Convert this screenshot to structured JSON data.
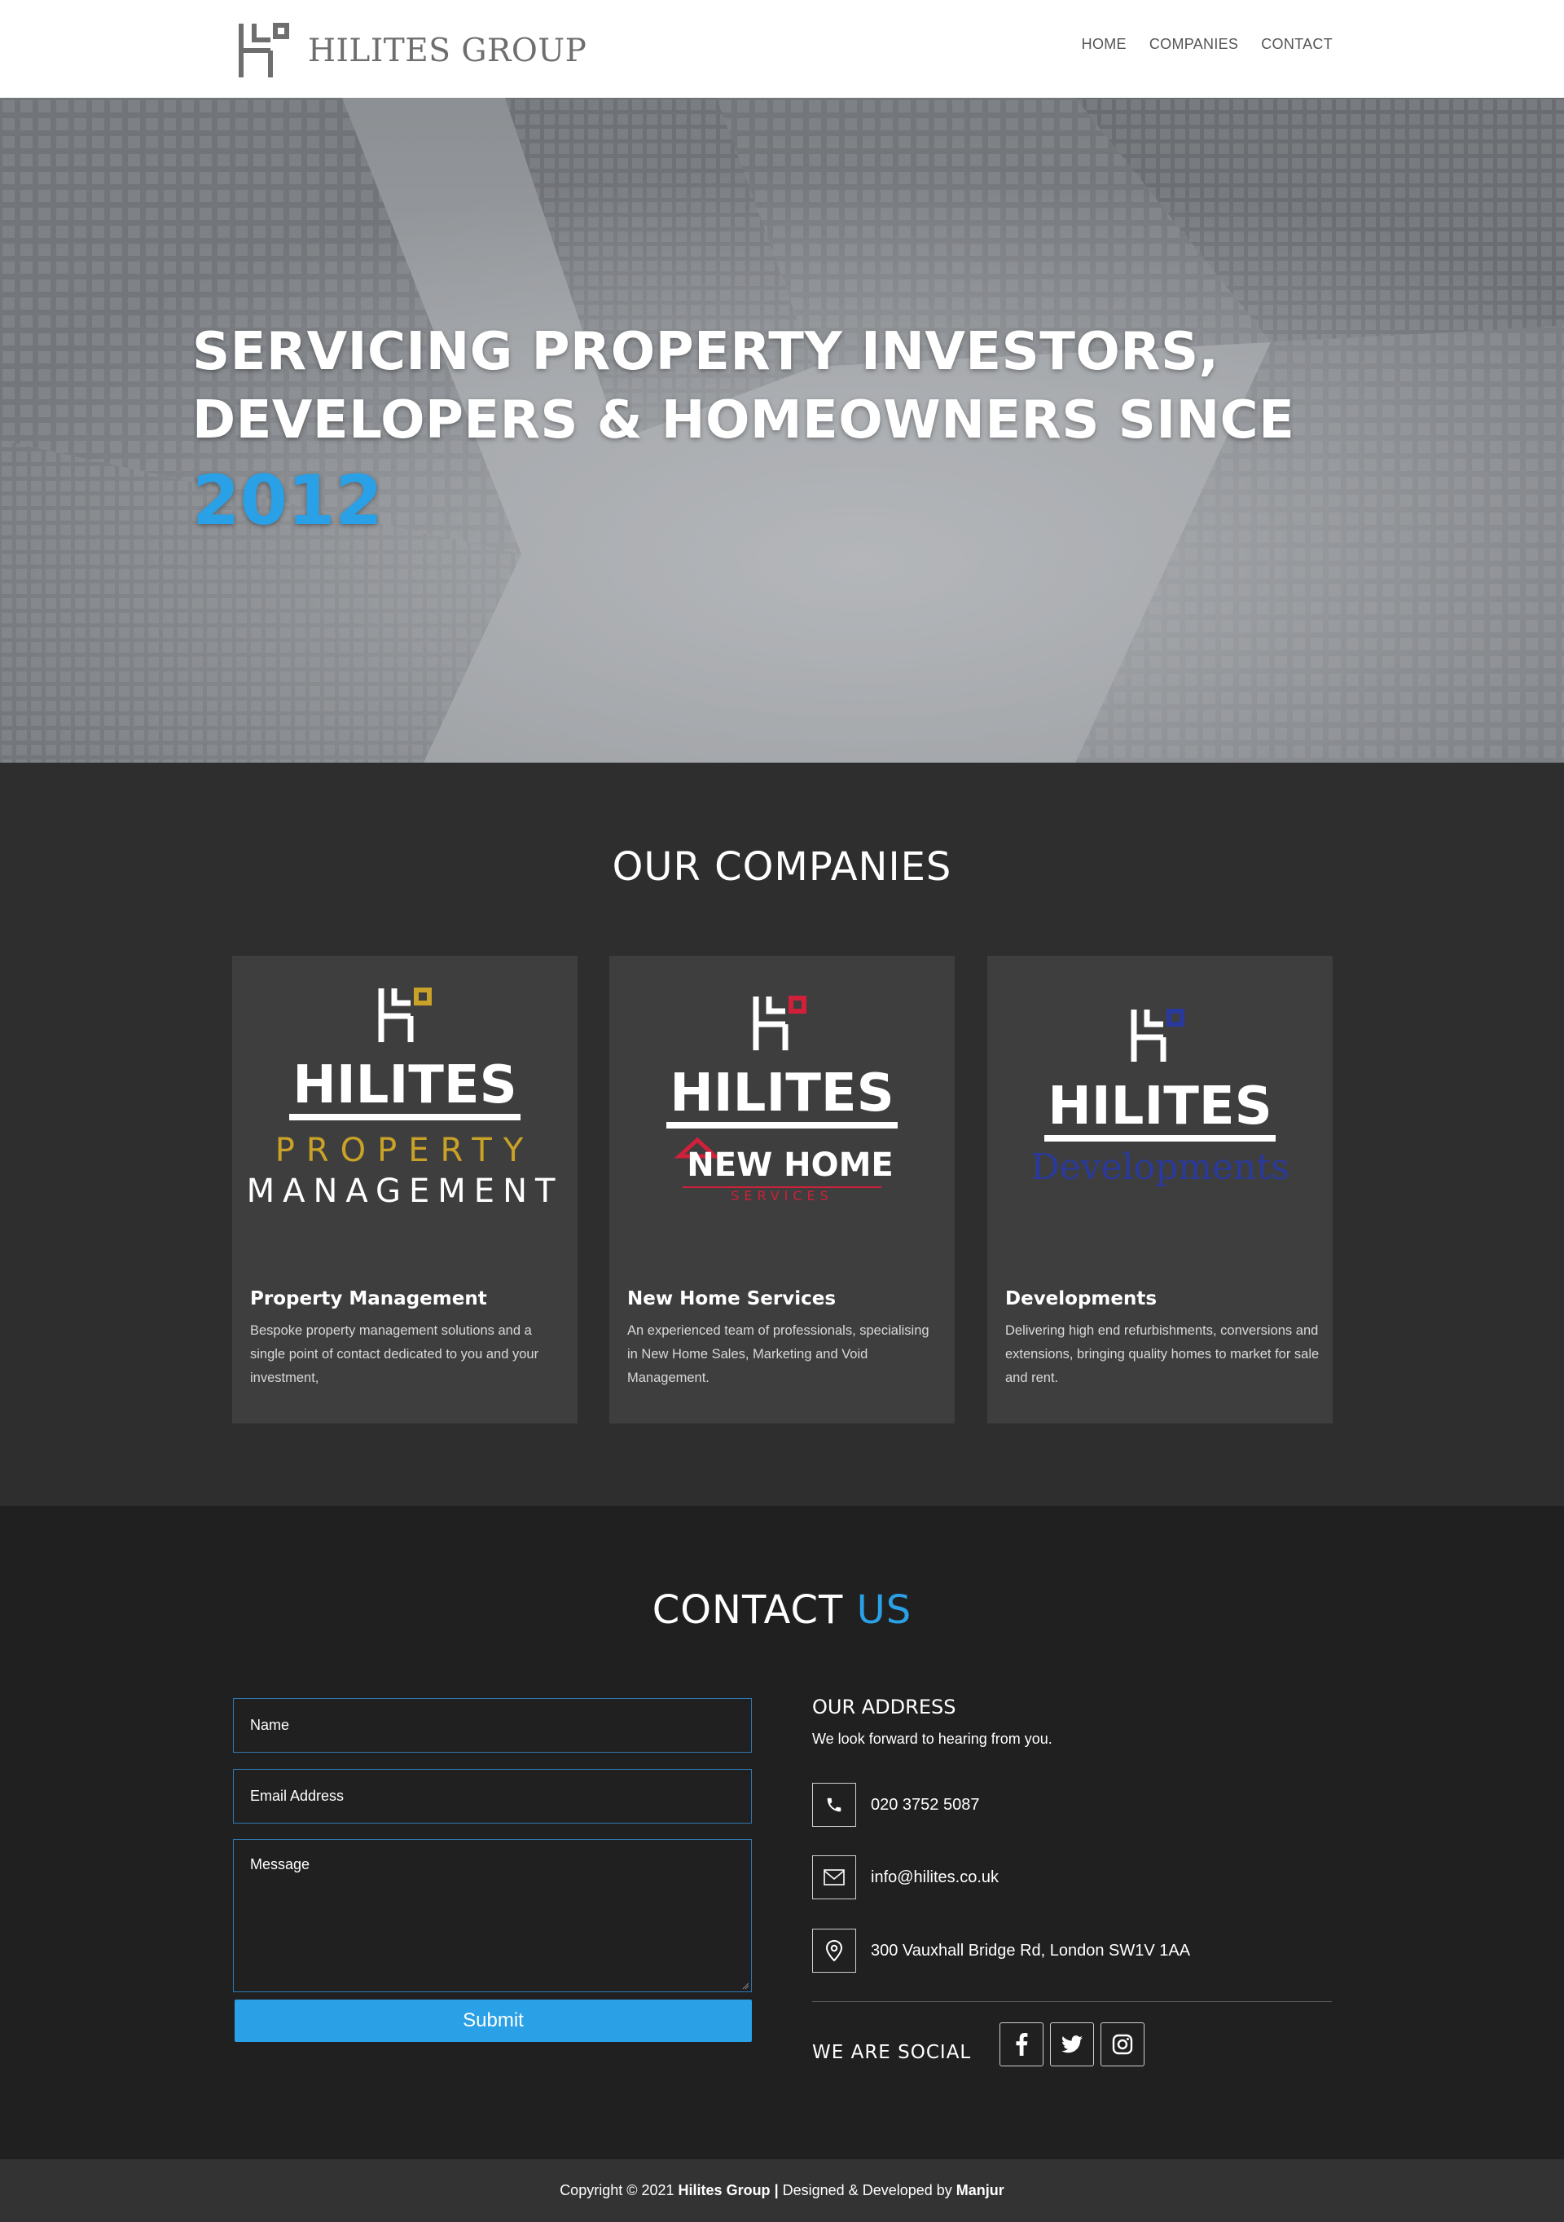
{
  "header": {
    "logo_text": "HILITES GROUP",
    "nav": [
      {
        "label": "HOME"
      },
      {
        "label": "COMPANIES"
      },
      {
        "label": "CONTACT"
      }
    ]
  },
  "hero": {
    "line1": "SERVICING PROPERTY INVESTORS,",
    "line2": "DEVELOPERS & HOMEOWNERS SINCE",
    "year": "2012"
  },
  "companies": {
    "title": "OUR COMPANIES",
    "cards": [
      {
        "logo_word": "HILITES",
        "logo_sub1": "PROPERTY",
        "logo_sub2": "MANAGEMENT",
        "title": "Property Management",
        "description": "Bespoke property management solutions and a single point of contact dedicated to you and your investment,",
        "accent_color": "#c9a227"
      },
      {
        "logo_word": "HILITES",
        "logo_sub1": "NEW HOME",
        "logo_sub2": "SERVICES",
        "title": "New Home Services",
        "description": "An experienced team of professionals, specialising in New Home Sales, Marketing and Void Management.",
        "accent_color": "#d0203a"
      },
      {
        "logo_word": "HILITES",
        "logo_sub1": "Developments",
        "title": "Developments",
        "description": "Delivering high end refurbishments, conversions and extensions, bringing quality homes to market for sale and rent.",
        "accent_color": "#2a3a9c"
      }
    ]
  },
  "contact": {
    "title_main": "CONTACT",
    "title_accent": "US",
    "form": {
      "name_placeholder": "Name",
      "email_placeholder": "Email Address",
      "message_placeholder": "Message",
      "submit_label": "Submit"
    },
    "address": {
      "title": "OUR ADDRESS",
      "subtitle": "We look forward to hearing from you.",
      "phone": "020 3752 5087",
      "email": "info@hilites.co.uk",
      "location": "300 Vauxhall Bridge Rd, London SW1V 1AA",
      "phone_icon": "phone-icon",
      "email_icon": "envelope-icon",
      "location_icon": "map-pin-icon"
    },
    "social": {
      "label": "WE ARE SOCIAL",
      "networks": [
        "facebook-icon",
        "twitter-icon",
        "instagram-icon"
      ]
    }
  },
  "footer": {
    "prefix": "Copyright © 2021",
    "company": "Hilites Group",
    "separator": "|",
    "middle": "Designed & Developed by",
    "developer": "Manjur"
  },
  "colors": {
    "accent_blue": "#2aa0e6",
    "companies_bg": "#2e2e2e",
    "card_bg": "#3e3e3e",
    "contact_bg": "#202020",
    "footer_bg": "#333333"
  }
}
